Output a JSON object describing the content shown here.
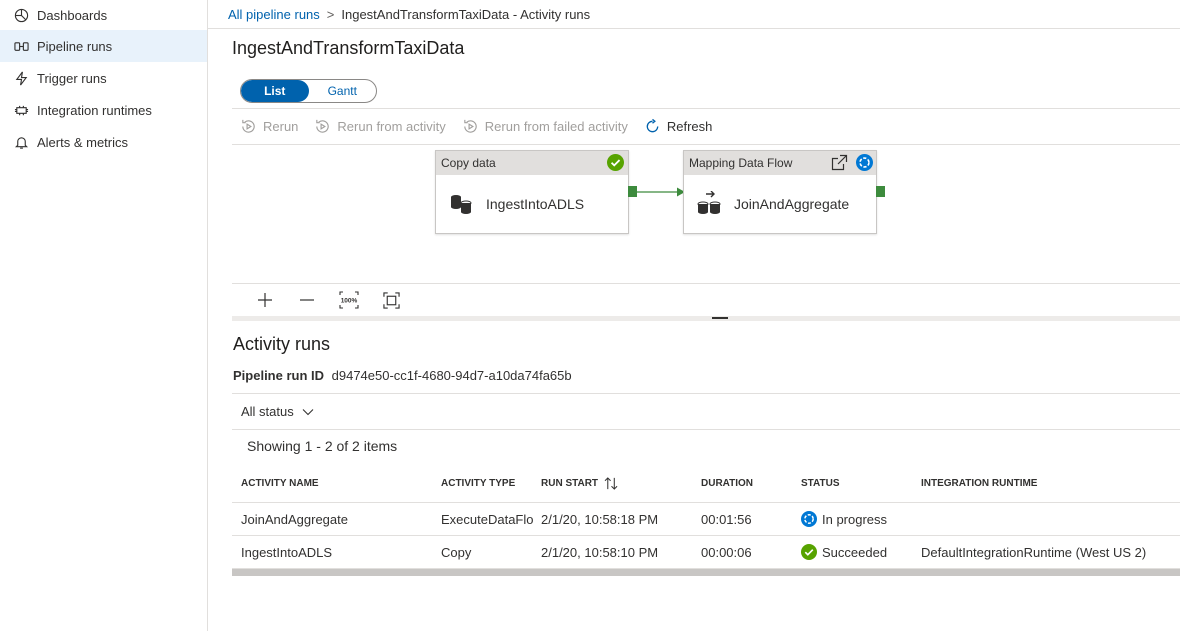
{
  "sidebar": {
    "items": [
      {
        "label": "Dashboards",
        "icon": "dashboard-icon"
      },
      {
        "label": "Pipeline runs",
        "icon": "pipeline-icon"
      },
      {
        "label": "Trigger runs",
        "icon": "trigger-icon"
      },
      {
        "label": "Integration runtimes",
        "icon": "runtime-icon"
      },
      {
        "label": "Alerts & metrics",
        "icon": "bell-icon"
      }
    ],
    "active_index": 1
  },
  "breadcrumb": {
    "link": "All pipeline runs",
    "separator": ">",
    "current": "IngestAndTransformTaxiData - Activity runs"
  },
  "page_title": "IngestAndTransformTaxiData",
  "view_toggle": {
    "list": "List",
    "gantt": "Gantt",
    "selected": "List"
  },
  "toolbar": {
    "rerun": "Rerun",
    "rerun_from_activity": "Rerun from activity",
    "rerun_from_failed": "Rerun from failed activity",
    "refresh": "Refresh"
  },
  "pipeline": {
    "nodes": [
      {
        "type_label": "Copy data",
        "name": "IngestIntoADLS",
        "status": "succeeded"
      },
      {
        "type_label": "Mapping Data Flow",
        "name": "JoinAndAggregate",
        "status": "in-progress"
      }
    ]
  },
  "activity_runs": {
    "title": "Activity runs",
    "run_id_label": "Pipeline run ID",
    "run_id": "d9474e50-cc1f-4680-94d7-a10da74fa65b",
    "filter_label": "All status",
    "showing": "Showing 1 - 2 of 2 items",
    "columns": [
      "ACTIVITY NAME",
      "ACTIVITY TYPE",
      "RUN START",
      "DURATION",
      "STATUS",
      "INTEGRATION RUNTIME"
    ],
    "rows": [
      {
        "name": "JoinAndAggregate",
        "type": "ExecuteDataFlow",
        "start": "2/1/20, 10:58:18 PM",
        "duration": "00:01:56",
        "status": "In progress",
        "status_icon": "in-progress-icon",
        "runtime": ""
      },
      {
        "name": "IngestIntoADLS",
        "type": "Copy",
        "start": "2/1/20, 10:58:10 PM",
        "duration": "00:00:06",
        "status": "Succeeded",
        "status_icon": "success-icon",
        "runtime": "DefaultIntegrationRuntime (West US 2)"
      }
    ]
  },
  "colors": {
    "accent": "#0062ad",
    "success": "#57a300",
    "in_progress": "#0078d4",
    "port": "#3d8b3d"
  }
}
